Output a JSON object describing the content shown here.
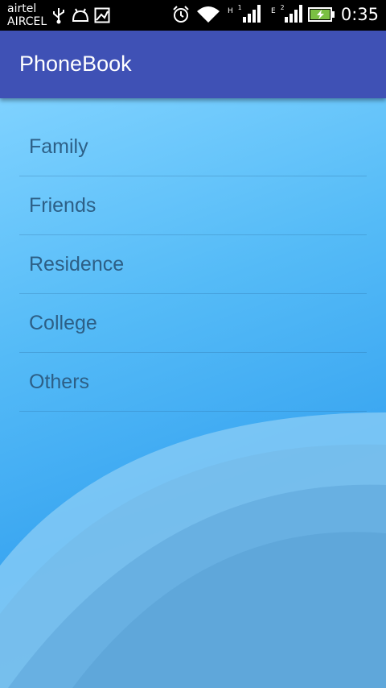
{
  "status_bar": {
    "carrier_1": "airtel",
    "carrier_2": "AIRCEL",
    "network_1": "H",
    "network_1_sim": "1",
    "network_2": "E",
    "network_2_sim": "2",
    "time": "0:35",
    "icons": [
      "usb-icon",
      "android-debug-icon",
      "image-icon",
      "alarm-icon",
      "wifi-icon",
      "signal-icon",
      "signal-icon",
      "battery-charging-icon"
    ]
  },
  "app_bar": {
    "title": "PhoneBook",
    "color": "#3f51b5"
  },
  "categories": [
    {
      "label": "Family"
    },
    {
      "label": "Friends"
    },
    {
      "label": "Residence"
    },
    {
      "label": "College"
    },
    {
      "label": "Others"
    }
  ]
}
